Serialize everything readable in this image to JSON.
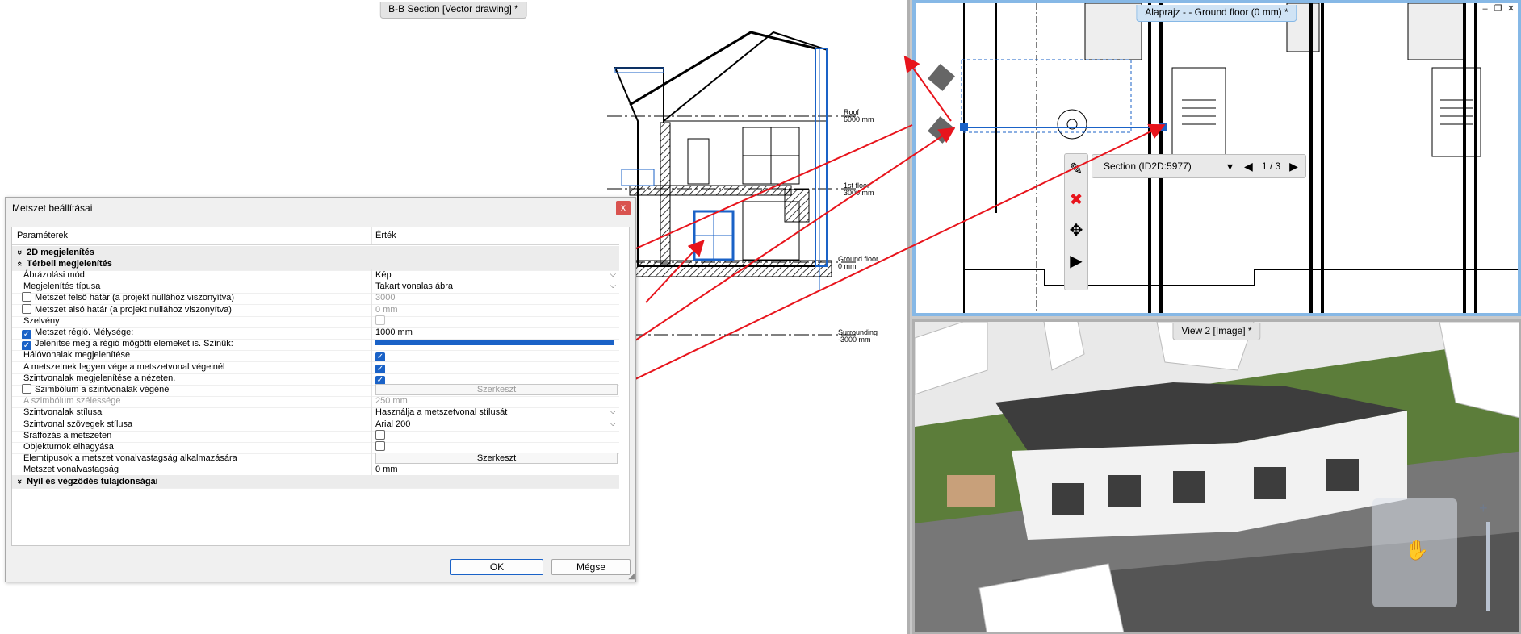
{
  "panes": {
    "section_title": "B-B Section [Vector drawing] *",
    "plan_title": "Alaprajz - - Ground floor (0 mm) *",
    "view_title": "View 2 [Image] *"
  },
  "section_labels": {
    "roof": "Roof",
    "roof_mm": "6000 mm",
    "first_floor": "1st floor",
    "first_floor_mm": "3000 mm",
    "ground_floor": "Ground floor",
    "ground_floor_mm": "0 mm",
    "surrounding": "Surrounding",
    "surrounding_mm": "-3000 mm"
  },
  "section_toolbar": {
    "label": "Section (ID2D:5977)",
    "page": "1 / 3"
  },
  "dialog": {
    "title": "Metszet beállításai",
    "close": "x",
    "col_param": "Paraméterek",
    "col_value": "Érték",
    "ok": "OK",
    "cancel": "Mégse",
    "rows": [
      {
        "type": "group",
        "label": "2D megjelenítés",
        "toggle": "»"
      },
      {
        "type": "group",
        "label": "Térbeli megjelenítés",
        "toggle": "«"
      },
      {
        "label": "Ábrázolási mód",
        "value": "Kép",
        "dropdown": true
      },
      {
        "label": "Megjelenítés típusa",
        "value": "Takart vonalas ábra",
        "dropdown": true
      },
      {
        "label": "Metszet felső határ (a projekt nullához viszonyítva)",
        "check": "off",
        "value": "3000",
        "disabledValue": true
      },
      {
        "label": "Metszet alsó határ (a projekt nullához viszonyítva)",
        "check": "off",
        "value": "0 mm",
        "disabledValue": true
      },
      {
        "label": "Szelvény",
        "valueCheck": "dim"
      },
      {
        "label": "Metszet régió. Mélysége:",
        "check": "on",
        "value": "1000 mm"
      },
      {
        "label": "Jelenítse meg a régió mögötti elemeket is. Színük:",
        "check": "on",
        "colorbar": "#1a62c7"
      },
      {
        "label": "Hálóvonalak megjelenítése",
        "valueCheck": "on"
      },
      {
        "label": "A metszetnek legyen vége a metszetvonal végeinél",
        "valueCheck": "on"
      },
      {
        "label": "Szintvonalak megjelenítése a nézeten.",
        "valueCheck": "on"
      },
      {
        "label": "Szimbólum a szintvonalak végénél",
        "check": "off",
        "button": "Szerkeszt",
        "disabledValue": true
      },
      {
        "label": "A szimbólum szélessége",
        "value": "250 mm",
        "disabled": true
      },
      {
        "label": "Szintvonalak stílusa",
        "value": "Használja a metszetvonal stílusát",
        "dropdown": true
      },
      {
        "label": "Szintvonal szövegek stílusa",
        "value": "Arial 200",
        "dropdown": true
      },
      {
        "label": "Sraffozás a metszeten",
        "valueCheck": "off"
      },
      {
        "label": "Objektumok elhagyása",
        "valueCheck": "off"
      },
      {
        "label": "Elemtípusok a metszet vonalvastagság alkalmazására",
        "button": "Szerkeszt"
      },
      {
        "label": "Metszet vonalvastagság",
        "value": "0 mm"
      },
      {
        "type": "group",
        "label": "Nyíl és végződés tulajdonságai",
        "toggle": "»"
      }
    ]
  },
  "colors": {
    "accent": "#1a62c7",
    "arrow": "#e8141c",
    "grass": "#5c7d3a",
    "roof": "#3d3d3d"
  }
}
